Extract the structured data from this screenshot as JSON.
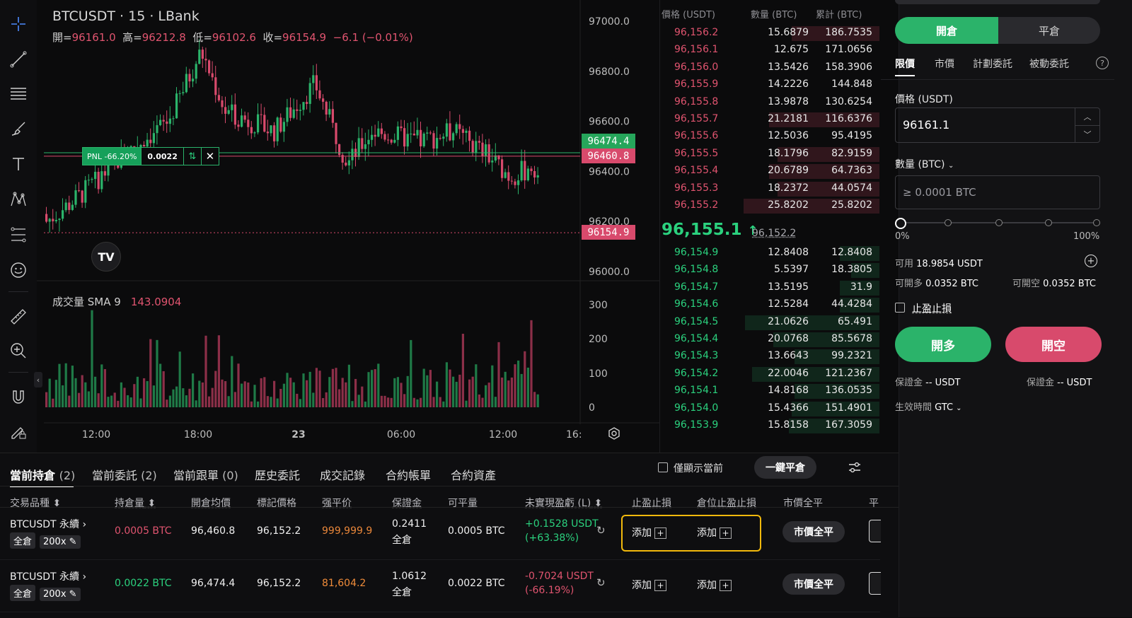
{
  "chart": {
    "title": "BTCUSDT · 15 · LBank",
    "ohlc": {
      "open_label": "開=",
      "open": "96161.0",
      "high_label": "高=",
      "high": "96212.8",
      "low_label": "低=",
      "low": "96102.6",
      "close_label": "收=",
      "close": "96154.9",
      "change": "−6.1 (−0.01%)"
    },
    "price_axis": [
      "97000.0",
      "96800.0",
      "96600.0",
      "96400.0",
      "96200.0",
      "96000.0"
    ],
    "tags": {
      "long_entry": "96474.4",
      "short_entry": "96460.8",
      "last": "96154.9"
    },
    "pnl": {
      "label": "PNL -66.20%",
      "qty": "0.0022",
      "swap": "⇅",
      "close": "✕"
    },
    "volume_label": "成交量 SMA 9",
    "volume_value": "143.0904",
    "volume_axis": [
      "300",
      "200",
      "100",
      "0"
    ],
    "time_axis": [
      "12:00",
      "18:00",
      "23",
      "06:00",
      "12:00",
      "16:"
    ],
    "logo": "TV"
  },
  "orderbook": {
    "headers": {
      "price": "價格 (USDT)",
      "qty": "數量 (BTC)",
      "total": "累計 (BTC)"
    },
    "asks": [
      {
        "price": "96,156.2",
        "qty": "15.6879",
        "total": "186.7535",
        "depth": 0.62
      },
      {
        "price": "96,156.1",
        "qty": "12.675",
        "total": "171.0656",
        "depth": 0.0
      },
      {
        "price": "96,156.0",
        "qty": "13.5426",
        "total": "158.3906",
        "depth": 0.0
      },
      {
        "price": "96,155.9",
        "qty": "14.2226",
        "total": "144.848",
        "depth": 0.0
      },
      {
        "price": "96,155.8",
        "qty": "13.9878",
        "total": "130.6254",
        "depth": 0.0
      },
      {
        "price": "96,155.7",
        "qty": "21.2181",
        "total": "116.6376",
        "depth": 0.78
      },
      {
        "price": "96,155.6",
        "qty": "12.5036",
        "total": "95.4195",
        "depth": 0.0
      },
      {
        "price": "96,155.5",
        "qty": "18.1796",
        "total": "82.9159",
        "depth": 0.72
      },
      {
        "price": "96,155.4",
        "qty": "20.6789",
        "total": "64.7363",
        "depth": 0.78
      },
      {
        "price": "96,155.3",
        "qty": "18.2372",
        "total": "44.0574",
        "depth": 0.72
      },
      {
        "price": "96,155.2",
        "qty": "25.8202",
        "total": "25.8202",
        "depth": 0.96
      }
    ],
    "mid": {
      "price": "96,155.1",
      "arrow": "↑",
      "mark": "96,152.2"
    },
    "bids": [
      {
        "price": "96,154.9",
        "qty": "12.8408",
        "total": "12.8408",
        "depth": 0.28
      },
      {
        "price": "96,154.8",
        "qty": "5.5397",
        "total": "18.3805",
        "depth": 0.2
      },
      {
        "price": "96,154.7",
        "qty": "13.5195",
        "total": "31.9",
        "depth": 0.28
      },
      {
        "price": "96,154.6",
        "qty": "12.5284",
        "total": "44.4284",
        "depth": 0.28
      },
      {
        "price": "96,154.5",
        "qty": "21.0626",
        "total": "65.491",
        "depth": 0.95
      },
      {
        "price": "96,154.4",
        "qty": "20.0768",
        "total": "85.5678",
        "depth": 0.75
      },
      {
        "price": "96,154.3",
        "qty": "13.6643",
        "total": "99.2321",
        "depth": 0.6
      },
      {
        "price": "96,154.2",
        "qty": "22.0046",
        "total": "121.2367",
        "depth": 0.9
      },
      {
        "price": "96,154.1",
        "qty": "14.8168",
        "total": "136.0535",
        "depth": 0.6
      },
      {
        "price": "96,154.0",
        "qty": "15.4366",
        "total": "151.4901",
        "depth": 0.62
      },
      {
        "price": "96,153.9",
        "qty": "15.8158",
        "total": "167.3059",
        "depth": 0.64
      }
    ]
  },
  "panel": {
    "open_tab": "開倉",
    "close_tab": "平倉",
    "order_types": [
      "限價",
      "市價",
      "計劃委託",
      "被動委託"
    ],
    "help": "?",
    "price_label": "價格 (USDT)",
    "price_value": "96161.1",
    "qty_label": "數量 (BTC)",
    "qty_placeholder": "≥ 0.0001 BTC",
    "slider_min": "0%",
    "slider_max": "100%",
    "available_label": "可用",
    "available": "18.9854 USDT",
    "can_long_label": "可開多",
    "can_long": "0.0352 BTC",
    "can_short_label": "可開空",
    "can_short": "0.0352 BTC",
    "tpsl": "止盈止損",
    "long_btn": "開多",
    "short_btn": "開空",
    "margin_label": "保證金",
    "margin_value": "-- USDT",
    "margin_label2": "保證金",
    "margin_value2": "-- USDT",
    "tif_label": "生效時間",
    "tif_value": "GTC"
  },
  "bottom": {
    "tabs": [
      "當前持倉",
      "(2)",
      "當前委託",
      "(2)",
      "當前跟單",
      "(0)",
      "歷史委託",
      "成交記錄",
      "合約帳單",
      "合約資產"
    ],
    "only_current": "僅顯示當前",
    "close_all": "一鍵平倉",
    "headers": [
      "交易品種",
      "持倉量",
      "開倉均價",
      "標記價格",
      "强平价",
      "保證金",
      "可平量",
      "未實現盈虧 (L)",
      "止盈止損",
      "倉位止盈止損",
      "市價全平",
      "平"
    ],
    "rows": [
      {
        "symbol": "BTCUSDT 永續",
        "mode": "全倉",
        "lev": "200x",
        "size": "0.0005 BTC",
        "entry": "96,460.8",
        "mark": "96,152.2",
        "liq": "999,999.9",
        "margin": "0.2411",
        "margin_mode": "全倉",
        "closable": "0.0005 BTC",
        "pnl": "+0.1528 USDT",
        "pnl_pct": "(+63.38%)",
        "tp": "添加",
        "pos_tp": "添加",
        "close": "市價全平"
      },
      {
        "symbol": "BTCUSDT 永續",
        "mode": "全倉",
        "lev": "200x",
        "size": "0.0022 BTC",
        "entry": "96,474.4",
        "mark": "96,152.2",
        "liq": "81,604.2",
        "margin": "1.0612",
        "margin_mode": "全倉",
        "closable": "0.0022 BTC",
        "pnl": "-0.7024 USDT",
        "pnl_pct": "(-66.19%)",
        "tp": "添加",
        "pos_tp": "添加",
        "close": "市價全平"
      }
    ]
  },
  "colors": {
    "up": "#2bb36a",
    "down": "#d84a6c",
    "accent": "#f2b90c"
  }
}
